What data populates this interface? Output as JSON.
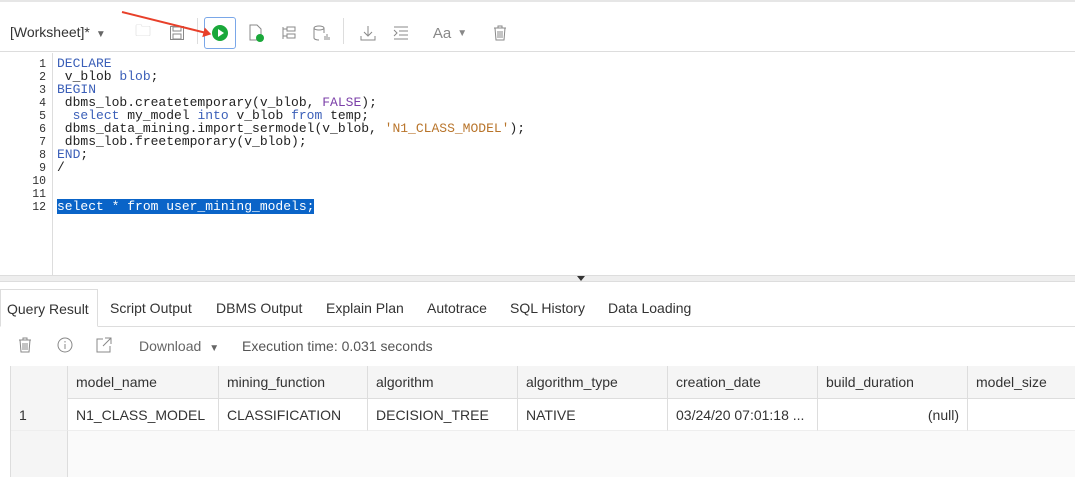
{
  "toolbar": {
    "worksheet_label": "[Worksheet]*",
    "font_label": "Aa"
  },
  "editor": {
    "line_numbers": [
      "1",
      "2",
      "3",
      "4",
      "5",
      "6",
      "7",
      "8",
      "9",
      "10",
      "11",
      "12"
    ],
    "lines": [
      [
        {
          "t": "DECLARE",
          "c": "kw"
        }
      ],
      [
        {
          "t": " v_blob ",
          "c": ""
        },
        {
          "t": "blob",
          "c": "kw"
        },
        {
          "t": ";",
          "c": ""
        }
      ],
      [
        {
          "t": "BEGIN",
          "c": "kw"
        }
      ],
      [
        {
          "t": " dbms_lob.createtemporary(v_blob, ",
          "c": ""
        },
        {
          "t": "FALSE",
          "c": "lit"
        },
        {
          "t": ");",
          "c": ""
        }
      ],
      [
        {
          "t": "  ",
          "c": ""
        },
        {
          "t": "select",
          "c": "kw"
        },
        {
          "t": " my_model ",
          "c": ""
        },
        {
          "t": "into",
          "c": "kw"
        },
        {
          "t": " v_blob ",
          "c": ""
        },
        {
          "t": "from",
          "c": "kw"
        },
        {
          "t": " temp;",
          "c": ""
        }
      ],
      [
        {
          "t": " dbms_data_mining.import_sermodel(v_blob, ",
          "c": ""
        },
        {
          "t": "'N1_CLASS_MODEL'",
          "c": "str"
        },
        {
          "t": ");",
          "c": ""
        }
      ],
      [
        {
          "t": " dbms_lob.freetemporary(v_blob);",
          "c": ""
        }
      ],
      [
        {
          "t": "END",
          "c": "kw"
        },
        {
          "t": ";",
          "c": ""
        }
      ],
      [
        {
          "t": "/",
          "c": ""
        }
      ],
      [],
      [],
      [
        {
          "t": "select * from user_mining_models;",
          "c": "sel"
        }
      ]
    ]
  },
  "tabs": [
    "Query Result",
    "Script Output",
    "DBMS Output",
    "Explain Plan",
    "Autotrace",
    "SQL History",
    "Data Loading"
  ],
  "result_toolbar": {
    "download_label": "Download",
    "execution_time": "Execution time: 0.031 seconds"
  },
  "grid": {
    "columns": [
      "model_name",
      "mining_function",
      "algorithm",
      "algorithm_type",
      "creation_date",
      "build_duration",
      "model_size"
    ],
    "rows": [
      {
        "num": "1",
        "cells": [
          "N1_CLASS_MODEL",
          "CLASSIFICATION",
          "DECISION_TREE",
          "NATIVE",
          "03/24/20 07:01:18 ...",
          "(null)",
          ""
        ]
      }
    ]
  }
}
